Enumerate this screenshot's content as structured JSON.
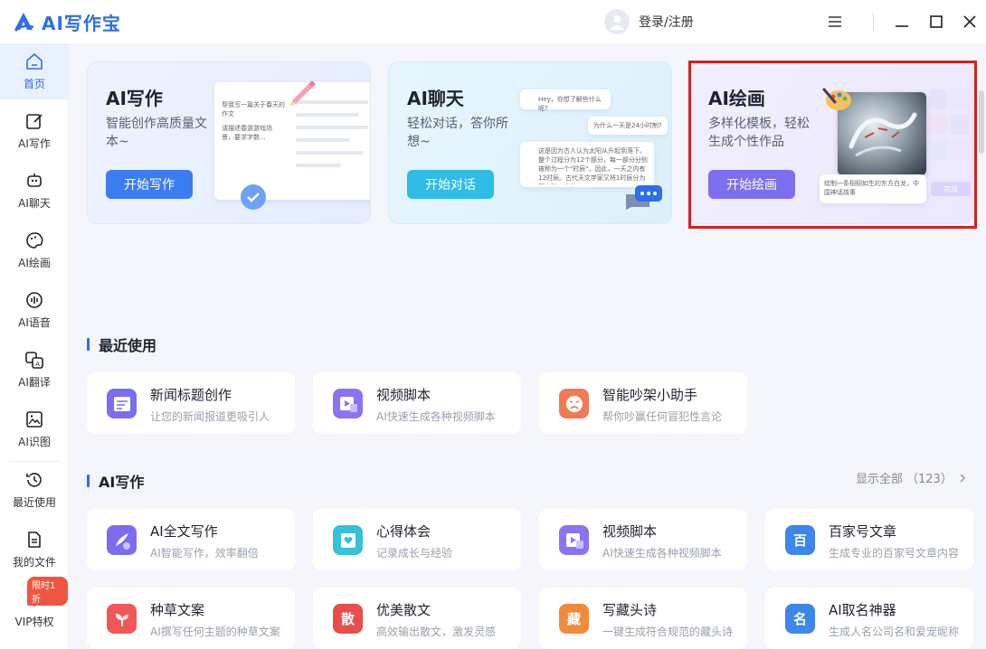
{
  "app": {
    "name": "AI写作宝"
  },
  "header": {
    "login_label": "登录/注册"
  },
  "sidebar": {
    "items": [
      {
        "label": "首页",
        "icon": "home-icon",
        "active": true
      },
      {
        "label": "AI写作",
        "icon": "pen-edit-icon"
      },
      {
        "label": "AI聊天",
        "icon": "chat-bot-icon"
      },
      {
        "label": "AI绘画",
        "icon": "palette-icon"
      },
      {
        "label": "AI语音",
        "icon": "audio-wave-icon"
      },
      {
        "label": "AI翻译",
        "icon": "translate-icon"
      },
      {
        "label": "AI识图",
        "icon": "image-recognize-icon"
      },
      {
        "label": "最近使用",
        "icon": "history-icon"
      },
      {
        "label": "我的文件",
        "icon": "file-icon"
      },
      {
        "label": "VIP特权",
        "icon": "diamond-icon"
      }
    ],
    "vip_badge": "限时1折"
  },
  "hero": {
    "write": {
      "title": "AI写作",
      "desc": "智能创作高质量文本~",
      "button": "开始写作",
      "mock_prompt": "帮我写一篇关于春天的作文",
      "mock_reply": "请描述春游游戏场景，要求字数..."
    },
    "chat": {
      "title": "AI聊天",
      "desc": "轻松对话，答你所想~",
      "button": "开始对话",
      "bubble_1": "Hey，你想了解些什么呢?",
      "bubble_2": "为什么一天是24小时制?",
      "bubble_3": "这是因为古人认为太阳从升起到落下，整个过程分为12个部分，每一部分分别被称为一个\"时辰\"，因此，一天之内有12时辰。古代天文学家又将1时辰分为两小时，由此..."
    },
    "draw": {
      "title": "AI绘画",
      "desc": "多样化模板，轻松生成个性作品",
      "button": "开始绘画",
      "mock_prompt": "绘制一条栩栩如生的东方白龙，中国神话故事",
      "mock_done": "完成"
    }
  },
  "recent": {
    "title": "最近使用",
    "items": [
      {
        "name": "新闻标题创作",
        "desc": "让您的新闻报道更吸引人",
        "icon": "news-title-icon",
        "color": "#7b6cf0"
      },
      {
        "name": "视频脚本",
        "desc": "AI快速生成各种视频脚本",
        "icon": "video-script-icon",
        "color": "#8a74f2"
      },
      {
        "name": "智能吵架小助手",
        "desc": "帮你吵赢任何冒犯性言论",
        "icon": "angry-face-icon",
        "color": "#f07a55"
      }
    ]
  },
  "writing": {
    "title": "AI写作",
    "show_all": "显示全部",
    "count": "（123）",
    "items": [
      {
        "name": "AI全文写作",
        "desc": "AI智能写作，效率翻倍",
        "icon": "quill-icon",
        "color": "#7b6cf0"
      },
      {
        "name": "心得体会",
        "desc": "记录成长与经验",
        "icon": "book-heart-icon",
        "color": "#35c1d8"
      },
      {
        "name": "视频脚本",
        "desc": "AI快速生成各种视频脚本",
        "icon": "video-script-icon",
        "color": "#8a74f2"
      },
      {
        "name": "百家号文章",
        "desc": "生成专业的百家号文章内容",
        "icon": "baijia-icon",
        "glyph": "百",
        "color": "#3c86ec"
      },
      {
        "name": "种草文案",
        "desc": "AI撰写任何主题的种草文案",
        "icon": "sprout-icon",
        "color": "#f05858"
      },
      {
        "name": "优美散文",
        "desc": "高效输出散文，激发灵感",
        "icon": "essay-icon",
        "glyph": "散",
        "color": "#e84d4d"
      },
      {
        "name": "写藏头诗",
        "desc": "一键生成符合规范的藏头诗",
        "icon": "poem-icon",
        "glyph": "藏",
        "color": "#f28a3c"
      },
      {
        "name": "AI取名神器",
        "desc": "生成人名公司名和爱宠昵称",
        "icon": "naming-icon",
        "glyph": "名",
        "color": "#3c86ec"
      }
    ]
  },
  "colors": {
    "brand": "#2f6ee8",
    "highlight": "#d61f1f"
  }
}
